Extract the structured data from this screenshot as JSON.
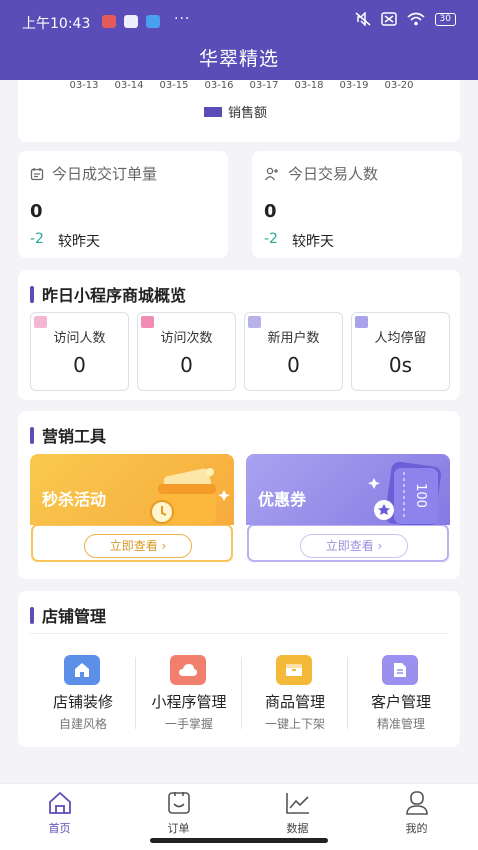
{
  "status_bar": {
    "time": "上午10:43",
    "dots": "···",
    "battery": "30"
  },
  "header": {
    "title": "华翠精选"
  },
  "chart_data": {
    "type": "line",
    "x": [
      "03-13",
      "03-14",
      "03-15",
      "03-16",
      "03-17",
      "03-18",
      "03-19",
      "03-20"
    ],
    "series": [
      {
        "name": "销售额"
      }
    ],
    "colors": {
      "series": "#5a4db8"
    }
  },
  "stats": [
    {
      "label": "今日成交订单量",
      "value": "0",
      "delta": "-2",
      "compare": "较昨天"
    },
    {
      "label": "今日交易人数",
      "value": "0",
      "delta": "-2",
      "compare": "较昨天"
    }
  ],
  "overview": {
    "title": "昨日小程序商城概览",
    "items": [
      {
        "label": "访问人数",
        "value": "0"
      },
      {
        "label": "访问次数",
        "value": "0"
      },
      {
        "label": "新用户数",
        "value": "0"
      },
      {
        "label": "人均停留",
        "value": "0s"
      }
    ]
  },
  "marketing": {
    "title": "营销工具",
    "cards": [
      {
        "title": "秒杀活动",
        "button": "立即查看 ›"
      },
      {
        "title": "优惠券",
        "button": "立即查看 ›",
        "coupon_text": "100"
      }
    ]
  },
  "shop": {
    "title": "店铺管理",
    "items": [
      {
        "name": "店铺装修",
        "sub": "自建风格",
        "icon": "store-icon"
      },
      {
        "name": "小程序管理",
        "sub": "一手掌握",
        "icon": "cloud-icon"
      },
      {
        "name": "商品管理",
        "sub": "一键上下架",
        "icon": "box-icon"
      },
      {
        "name": "客户管理",
        "sub": "精准管理",
        "icon": "document-icon"
      }
    ]
  },
  "tabbar": [
    {
      "label": "首页",
      "icon": "home-icon",
      "active": true
    },
    {
      "label": "订单",
      "icon": "order-icon",
      "active": false
    },
    {
      "label": "数据",
      "icon": "chart-icon",
      "active": false
    },
    {
      "label": "我的",
      "icon": "profile-icon",
      "active": false
    }
  ]
}
